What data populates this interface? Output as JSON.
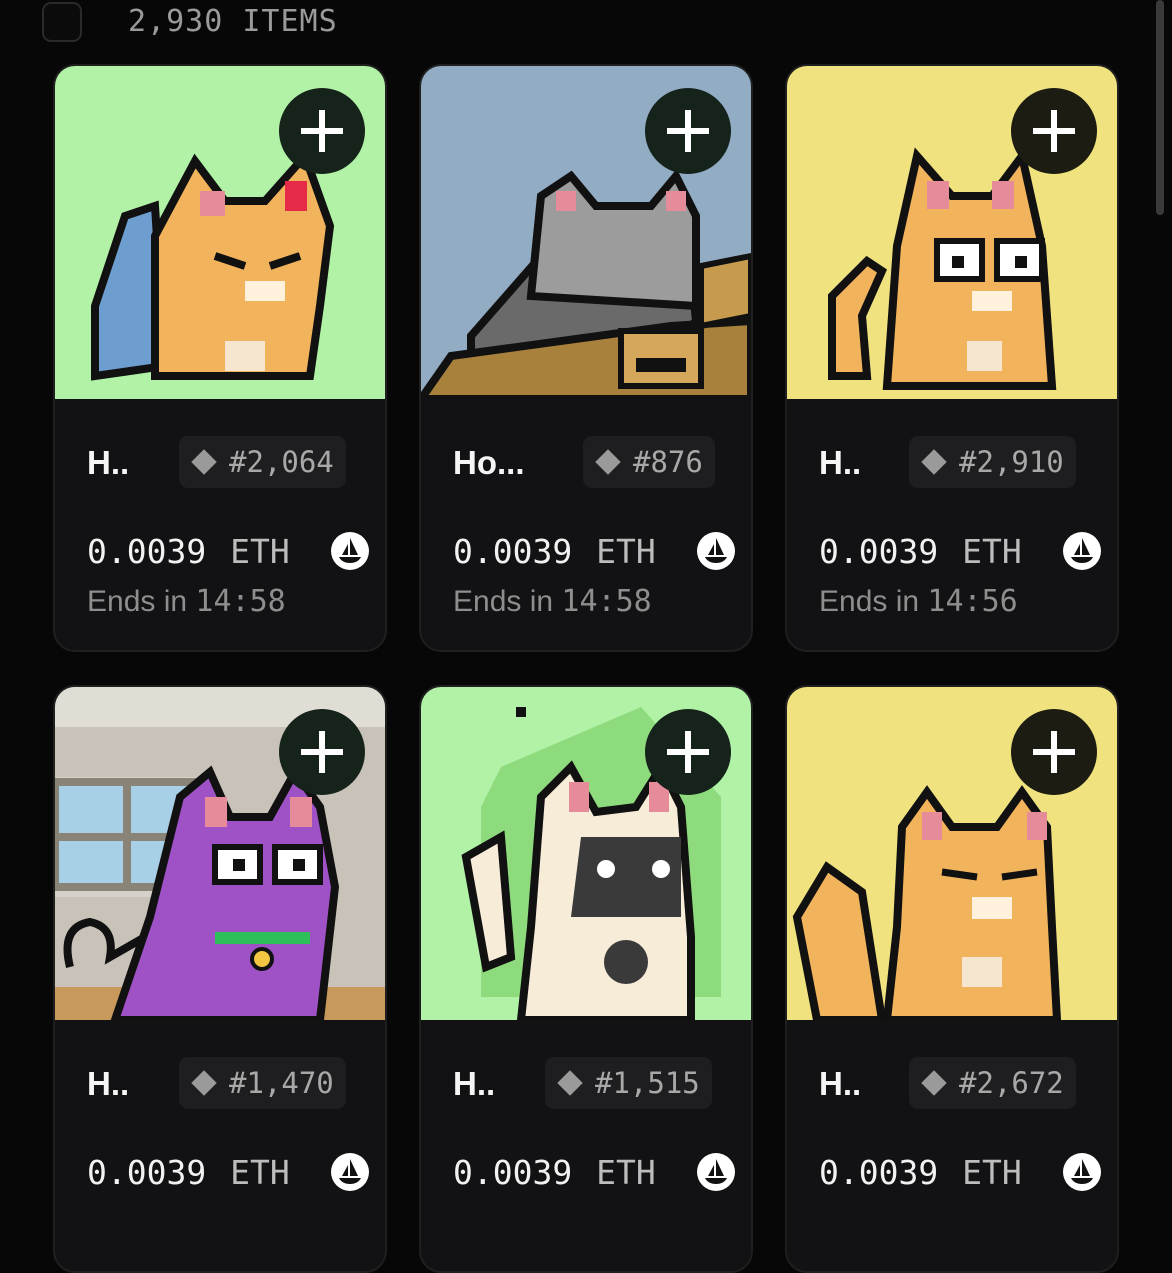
{
  "header": {
    "item_count": "2,930 ITEMS"
  },
  "cards": [
    {
      "name": "H..",
      "token": "#2,064",
      "price": "0.0039",
      "currency": "ETH",
      "ends_label": "Ends in",
      "ends_time": "14:58",
      "bg": "#b1f2a7",
      "cat": "orange cat with blue fish",
      "icon": "opensea-icon"
    },
    {
      "name": "Ho...",
      "token": "#876",
      "price": "0.0039",
      "currency": "ETH",
      "ends_label": "Ends in",
      "ends_time": "14:58",
      "bg": "#92acc4",
      "cat": "grey cat in cardboard box",
      "icon": "opensea-icon"
    },
    {
      "name": "H..",
      "token": "#2,910",
      "price": "0.0039",
      "currency": "ETH",
      "ends_label": "Ends in",
      "ends_time": "14:56",
      "bg": "#f0e27e",
      "cat": "orange cat with glasses",
      "icon": "opensea-icon"
    },
    {
      "name": "H..",
      "token": "#1,470",
      "price": "0.0039",
      "currency": "ETH",
      "bg": "#c9c2b8",
      "cat": "purple cat by window",
      "icon": "opensea-icon"
    },
    {
      "name": "H..",
      "token": "#1,515",
      "price": "0.0039",
      "currency": "ETH",
      "bg": "#b1f2a7",
      "cat": "siamese cat",
      "icon": "opensea-icon"
    },
    {
      "name": "H..",
      "token": "#2,672",
      "price": "0.0039",
      "currency": "ETH",
      "bg": "#f0e27e",
      "cat": "orange cat",
      "icon": "opensea-icon"
    }
  ]
}
